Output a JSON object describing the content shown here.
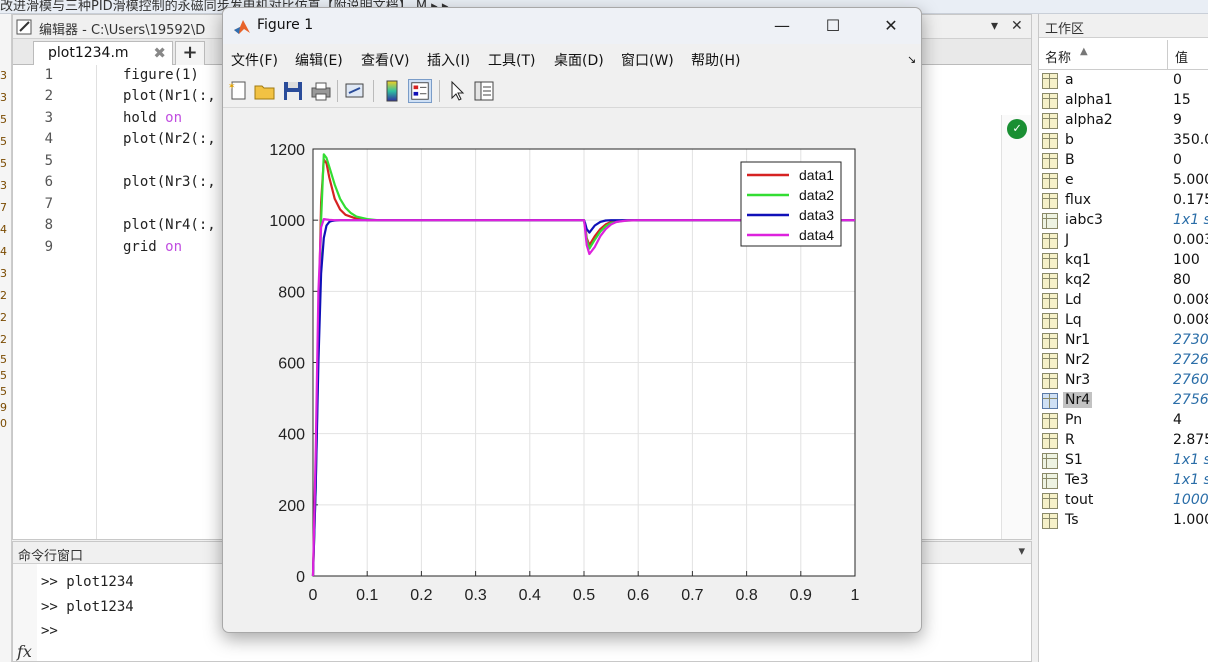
{
  "pathbar": {
    "text": "改进滑模与三种PID滑模控制的永磁同步发电机对比仿真【附说明文档】 M ▸ ▸"
  },
  "left_gutter": [
    "3",
    "3",
    "5",
    "5",
    "5",
    "3",
    "7",
    "4",
    "4",
    "3",
    "2",
    "2",
    "2",
    "5",
    "5",
    "5",
    "9",
    "0"
  ],
  "editor": {
    "title": "编辑器 - C:\\Users\\19592\\D",
    "tab_name": "plot1234.m",
    "tab_close": "✖",
    "tab_add": "+",
    "line_numbers": [
      "1",
      "2",
      "3",
      "4",
      "5",
      "6",
      "7",
      "8",
      "9"
    ],
    "code": {
      "l1": "figure(1)",
      "l2": "plot(Nr1(:,",
      "l3a": "hold ",
      "l3b": "on",
      "l4": "plot(Nr2(:,",
      "l6": "plot(Nr3(:,",
      "l8": "plot(Nr4(:,",
      "l9a": "grid ",
      "l9b": "on"
    },
    "ctrl_dropdown": "▾",
    "ctrl_close": "✕",
    "check": "✓"
  },
  "command_window": {
    "title": "命令行窗口",
    "lines": [
      ">> plot1234",
      ">> plot1234",
      ">>"
    ],
    "fx": "fx",
    "dropdown": "▾"
  },
  "workspace": {
    "title": "工作区",
    "col_name": "名称",
    "sort_arrow": "▲",
    "col_value": "值",
    "rows": [
      {
        "name": "a",
        "value": "0",
        "kind": "matrix"
      },
      {
        "name": "alpha1",
        "value": "15",
        "kind": "matrix"
      },
      {
        "name": "alpha2",
        "value": "9",
        "kind": "matrix"
      },
      {
        "name": "b",
        "value": "350.0",
        "kind": "matrix"
      },
      {
        "name": "B",
        "value": "0",
        "kind": "matrix"
      },
      {
        "name": "e",
        "value": "5.000",
        "kind": "matrix"
      },
      {
        "name": "flux",
        "value": "0.175",
        "kind": "matrix"
      },
      {
        "name": "iabc3",
        "value": "1x1 s",
        "kind": "struct"
      },
      {
        "name": "J",
        "value": "0.003",
        "kind": "matrix"
      },
      {
        "name": "kq1",
        "value": "100",
        "kind": "matrix"
      },
      {
        "name": "kq2",
        "value": "80",
        "kind": "matrix"
      },
      {
        "name": "Ld",
        "value": "0.008",
        "kind": "matrix"
      },
      {
        "name": "Lq",
        "value": "0.008",
        "kind": "matrix"
      },
      {
        "name": "Nr1",
        "value": "2730",
        "kind": "matrix"
      },
      {
        "name": "Nr2",
        "value": "2726",
        "kind": "matrix"
      },
      {
        "name": "Nr3",
        "value": "2760",
        "kind": "matrix"
      },
      {
        "name": "Nr4",
        "value": "2756",
        "kind": "matrix"
      },
      {
        "name": "Pn",
        "value": "4",
        "kind": "matrix"
      },
      {
        "name": "R",
        "value": "2.875",
        "kind": "matrix"
      },
      {
        "name": "S1",
        "value": "1x1 s",
        "kind": "struct"
      },
      {
        "name": "Te3",
        "value": "1x1 s",
        "kind": "struct"
      },
      {
        "name": "tout",
        "value": "1000",
        "kind": "matrix"
      },
      {
        "name": "Ts",
        "value": "1.000",
        "kind": "matrix"
      }
    ],
    "italic_rows": [
      "iabc3",
      "Nr1",
      "Nr2",
      "Nr3",
      "Nr4",
      "S1",
      "Te3",
      "tout"
    ],
    "selected": "Nr4"
  },
  "figure": {
    "title": "Figure 1",
    "minimize": "—",
    "maximize": "☐",
    "close": "✕",
    "menu": [
      "文件(F)",
      "编辑(E)",
      "查看(V)",
      "插入(I)",
      "工具(T)",
      "桌面(D)",
      "窗口(W)",
      "帮助(H)"
    ],
    "menu_arrow": "↘",
    "toolbar_icons": [
      "new-figure-icon",
      "open-file-icon",
      "save-icon",
      "print-icon",
      "link-plot-icon",
      "colorbar-icon",
      "legend-icon",
      "pointer-icon",
      "property-inspector-icon"
    ]
  },
  "chart_data": {
    "type": "line",
    "xlim": [
      0,
      1
    ],
    "ylim": [
      0,
      1200
    ],
    "xticks": [
      "0",
      "0.1",
      "0.2",
      "0.3",
      "0.4",
      "0.5",
      "0.6",
      "0.7",
      "0.8",
      "0.9",
      "1"
    ],
    "yticks": [
      "0",
      "200",
      "400",
      "600",
      "800",
      "1000",
      "1200"
    ],
    "grid": true,
    "legend_position": "top-right",
    "series": [
      {
        "name": "data1",
        "color": "#d62222",
        "x": [
          0,
          0.005,
          0.01,
          0.015,
          0.02,
          0.025,
          0.03,
          0.04,
          0.05,
          0.06,
          0.08,
          0.1,
          0.5,
          0.502,
          0.505,
          0.51,
          0.52,
          0.53,
          0.54,
          0.55,
          0.57,
          0.6,
          1
        ],
        "y": [
          0,
          300,
          700,
          1050,
          1170,
          1160,
          1120,
          1060,
          1030,
          1015,
          1004,
          1000,
          1000,
          985,
          950,
          930,
          955,
          975,
          988,
          995,
          999,
          1000,
          1000
        ]
      },
      {
        "name": "data2",
        "color": "#33dd33",
        "x": [
          0,
          0.005,
          0.01,
          0.015,
          0.02,
          0.025,
          0.03,
          0.04,
          0.05,
          0.06,
          0.07,
          0.08,
          0.1,
          0.12,
          0.5,
          0.502,
          0.505,
          0.51,
          0.52,
          0.53,
          0.54,
          0.55,
          0.57,
          0.6,
          1
        ],
        "y": [
          0,
          250,
          650,
          1000,
          1185,
          1175,
          1150,
          1100,
          1060,
          1035,
          1020,
          1010,
          1003,
          1000,
          1000,
          980,
          945,
          920,
          945,
          968,
          983,
          992,
          998,
          1000,
          1000
        ]
      },
      {
        "name": "data3",
        "color": "#1010b8",
        "x": [
          0,
          0.005,
          0.01,
          0.015,
          0.02,
          0.025,
          0.03,
          0.035,
          0.04,
          0.05,
          0.06,
          0.08,
          0.1,
          0.5,
          0.502,
          0.505,
          0.51,
          0.52,
          0.53,
          0.54,
          0.55,
          1
        ],
        "y": [
          0,
          250,
          600,
          850,
          950,
          985,
          995,
          998,
          999,
          1000,
          1000,
          1000,
          1000,
          1000,
          992,
          975,
          965,
          985,
          995,
          999,
          1000,
          1000
        ]
      },
      {
        "name": "data4",
        "color": "#dd22dd",
        "x": [
          0,
          0.005,
          0.01,
          0.015,
          0.02,
          0.025,
          0.03,
          0.04,
          0.06,
          0.1,
          0.5,
          0.502,
          0.505,
          0.51,
          0.52,
          0.53,
          0.54,
          0.55,
          0.56,
          0.58,
          0.6,
          1
        ],
        "y": [
          0,
          350,
          800,
          980,
          1003,
          1002,
          1001,
          1000,
          1000,
          1000,
          1000,
          975,
          930,
          905,
          925,
          955,
          975,
          988,
          995,
          999,
          1000,
          1000
        ]
      }
    ]
  }
}
